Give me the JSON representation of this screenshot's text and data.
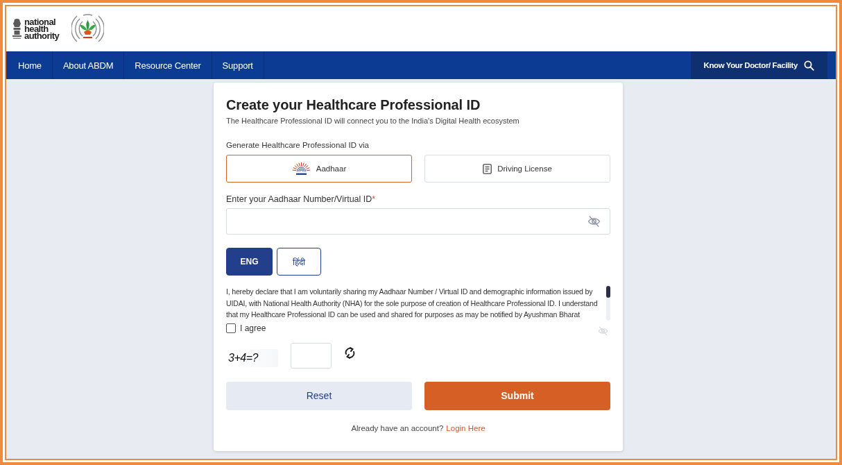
{
  "header": {
    "logo_text": "national health authority"
  },
  "nav": {
    "items": [
      {
        "label": "Home"
      },
      {
        "label": "About ABDM"
      },
      {
        "label": "Resource Center"
      },
      {
        "label": "Support"
      }
    ],
    "search_link": {
      "label": "Know Your Doctor/ Facility"
    }
  },
  "form": {
    "title": "Create your Healthcare Professional ID",
    "subtitle": "The Healthcare Professional ID will connect you to the India's Digital Health ecosystem",
    "method_label": "Generate Healthcare Professional ID via",
    "methods": [
      {
        "kind": "aadhaar",
        "label": "Aadhaar",
        "selected": true
      },
      {
        "kind": "document",
        "label": "Driving License",
        "selected": false
      }
    ],
    "id_field": {
      "label": "Enter your Aadhaar Number/Virtual ID",
      "required_mark": "*"
    },
    "languages": [
      {
        "label": "ENG",
        "selected": true
      },
      {
        "label": "हिंदी",
        "selected": false
      }
    ],
    "declaration": "I, hereby declare that I am voluntarily sharing my Aadhaar Number / Virtual ID and demographic information issued by UIDAI, with National Health Authority (NHA) for the sole purpose of creation of Healthcare Professional ID. I understand that my Healthcare Professional ID can be used and shared for purposes as may be notified by Ayushman Bharat",
    "agree": {
      "label": "I agree",
      "checked": false
    },
    "captcha": {
      "question": "3+4=?"
    },
    "buttons": [
      {
        "kind": "secondary",
        "label": "Reset"
      },
      {
        "kind": "primary",
        "label": "Submit"
      }
    ],
    "login": {
      "text": "Already have an account?",
      "link": "Login Here"
    }
  }
}
